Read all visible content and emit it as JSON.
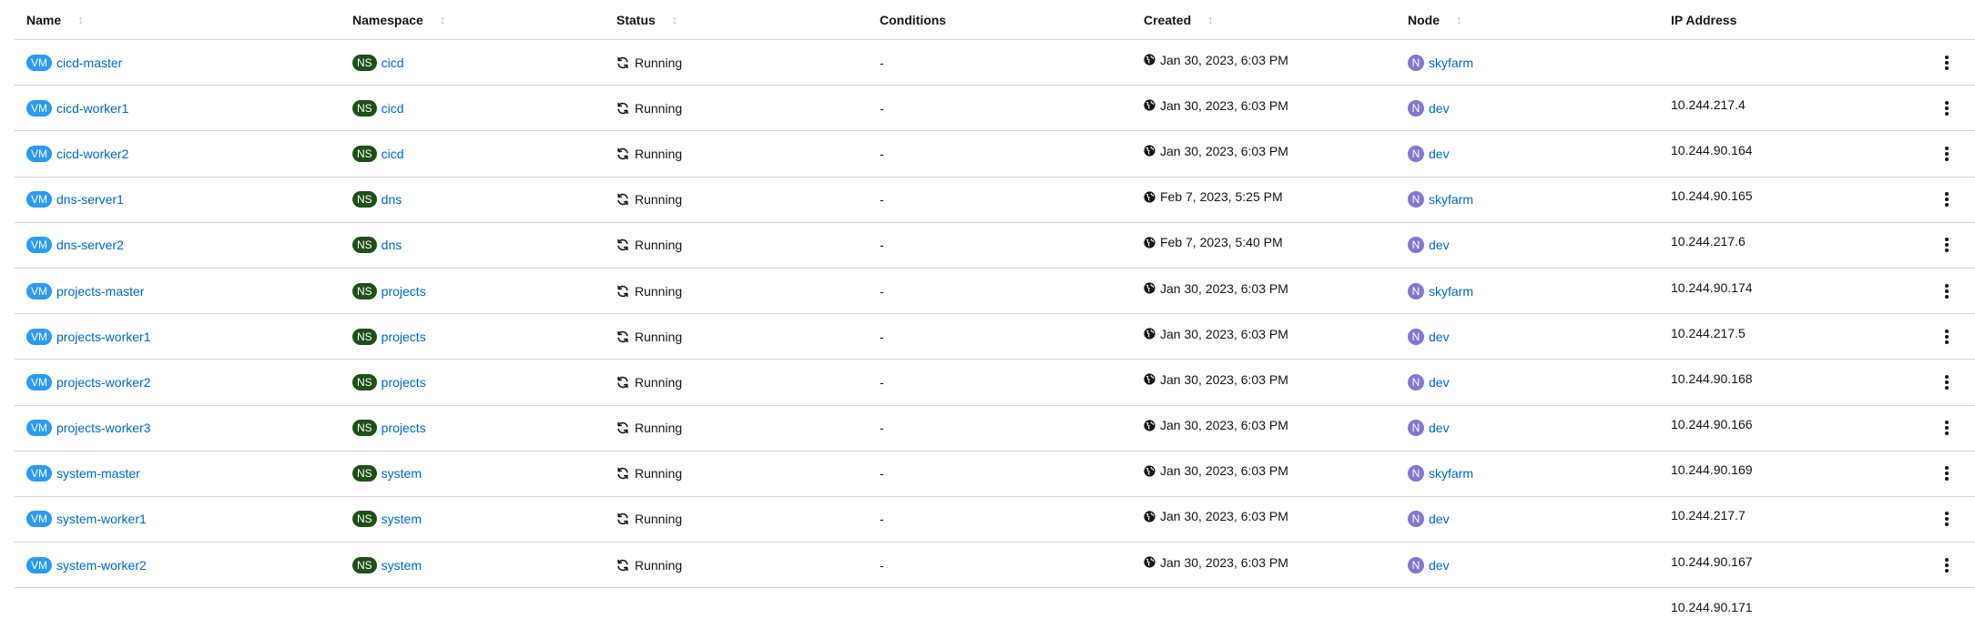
{
  "columns": {
    "name": "Name",
    "namespace": "Namespace",
    "status": "Status",
    "conditions": "Conditions",
    "created": "Created",
    "node": "Node",
    "ip": "IP Address"
  },
  "badges": {
    "vm": "VM",
    "ns": "NS",
    "node": "N"
  },
  "icons": {
    "sort": "sort-icon",
    "status": "sync-icon",
    "created": "globe-icon",
    "actions": "kebab-icon"
  },
  "colors": {
    "vm_badge": "#2b9af3",
    "ns_badge": "#1e4f18",
    "node_badge": "#8476d1",
    "link": "#0066cc",
    "divider": "#d2d2d2"
  },
  "rows": [
    {
      "name": "cicd-master",
      "namespace": "cicd",
      "status": "Running",
      "conditions": "-",
      "created": "Jan 30, 2023, 6:03 PM",
      "node": "skyfarm",
      "ip": "10.244.217.4"
    },
    {
      "name": "cicd-worker1",
      "namespace": "cicd",
      "status": "Running",
      "conditions": "-",
      "created": "Jan 30, 2023, 6:03 PM",
      "node": "dev",
      "ip": "10.244.90.164"
    },
    {
      "name": "cicd-worker2",
      "namespace": "cicd",
      "status": "Running",
      "conditions": "-",
      "created": "Jan 30, 2023, 6:03 PM",
      "node": "dev",
      "ip": "10.244.90.165"
    },
    {
      "name": "dns-server1",
      "namespace": "dns",
      "status": "Running",
      "conditions": "-",
      "created": "Feb 7, 2023, 5:25 PM",
      "node": "skyfarm",
      "ip": "10.244.217.6"
    },
    {
      "name": "dns-server2",
      "namespace": "dns",
      "status": "Running",
      "conditions": "-",
      "created": "Feb 7, 2023, 5:40 PM",
      "node": "dev",
      "ip": "10.244.90.174"
    },
    {
      "name": "projects-master",
      "namespace": "projects",
      "status": "Running",
      "conditions": "-",
      "created": "Jan 30, 2023, 6:03 PM",
      "node": "skyfarm",
      "ip": "10.244.217.5"
    },
    {
      "name": "projects-worker1",
      "namespace": "projects",
      "status": "Running",
      "conditions": "-",
      "created": "Jan 30, 2023, 6:03 PM",
      "node": "dev",
      "ip": "10.244.90.168"
    },
    {
      "name": "projects-worker2",
      "namespace": "projects",
      "status": "Running",
      "conditions": "-",
      "created": "Jan 30, 2023, 6:03 PM",
      "node": "dev",
      "ip": "10.244.90.166"
    },
    {
      "name": "projects-worker3",
      "namespace": "projects",
      "status": "Running",
      "conditions": "-",
      "created": "Jan 30, 2023, 6:03 PM",
      "node": "dev",
      "ip": "10.244.90.169"
    },
    {
      "name": "system-master",
      "namespace": "system",
      "status": "Running",
      "conditions": "-",
      "created": "Jan 30, 2023, 6:03 PM",
      "node": "skyfarm",
      "ip": "10.244.217.7"
    },
    {
      "name": "system-worker1",
      "namespace": "system",
      "status": "Running",
      "conditions": "-",
      "created": "Jan 30, 2023, 6:03 PM",
      "node": "dev",
      "ip": "10.244.90.167"
    },
    {
      "name": "system-worker2",
      "namespace": "system",
      "status": "Running",
      "conditions": "-",
      "created": "Jan 30, 2023, 6:03 PM",
      "node": "dev",
      "ip": "10.244.90.171"
    }
  ]
}
